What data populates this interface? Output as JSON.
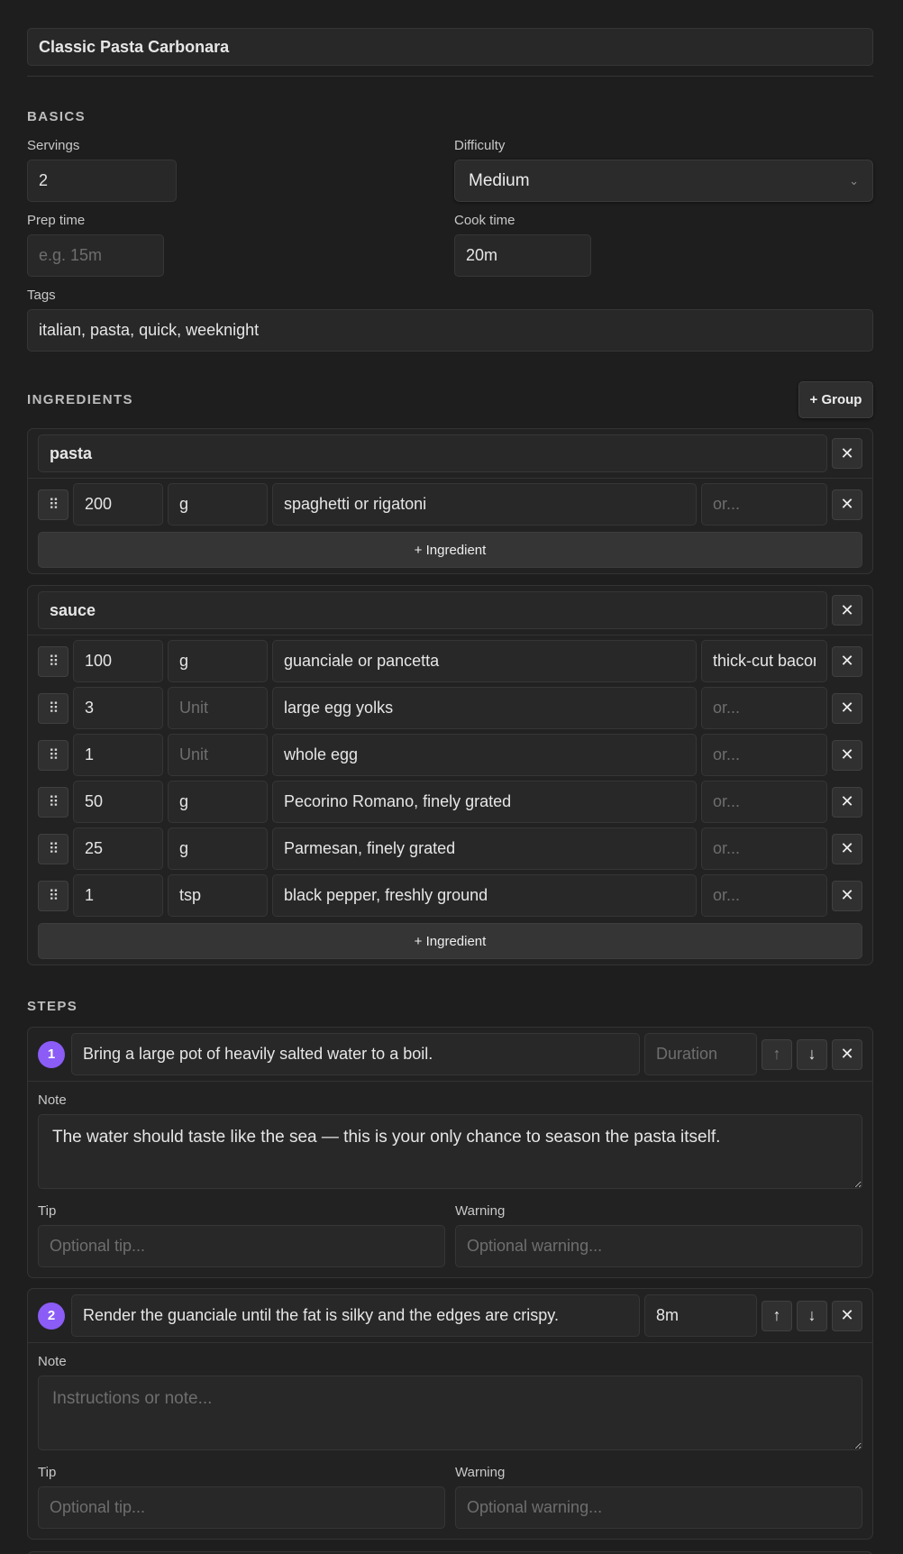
{
  "recipe": {
    "title": "Classic Pasta Carbonara"
  },
  "basics": {
    "section_label": "BASICS",
    "servings_label": "Servings",
    "servings_value": "2",
    "difficulty_label": "Difficulty",
    "difficulty_value": "Medium",
    "prep_label": "Prep time",
    "prep_value": "",
    "prep_placeholder": "e.g. 15m",
    "cook_label": "Cook time",
    "cook_value": "20m",
    "tags_label": "Tags",
    "tags_value": "italian, pasta, quick, weeknight"
  },
  "ingredients": {
    "section_label": "INGREDIENTS",
    "add_group_label": "+ Group",
    "add_ingredient_label": "+ Ingredient",
    "unit_placeholder": "Unit",
    "alt_placeholder": "or...",
    "groups": [
      {
        "name": "pasta",
        "items": [
          {
            "qty": "200",
            "unit": "g",
            "name": "spaghetti or rigatoni",
            "alt": ""
          }
        ]
      },
      {
        "name": "sauce",
        "items": [
          {
            "qty": "100",
            "unit": "g",
            "name": "guanciale or pancetta",
            "alt": "thick-cut bacon"
          },
          {
            "qty": "3",
            "unit": "",
            "name": "large egg yolks",
            "alt": ""
          },
          {
            "qty": "1",
            "unit": "",
            "name": "whole egg",
            "alt": ""
          },
          {
            "qty": "50",
            "unit": "g",
            "name": "Pecorino Romano, finely grated",
            "alt": ""
          },
          {
            "qty": "25",
            "unit": "g",
            "name": "Parmesan, finely grated",
            "alt": ""
          },
          {
            "qty": "1",
            "unit": "tsp",
            "name": "black pepper, freshly ground",
            "alt": ""
          }
        ]
      }
    ]
  },
  "steps": {
    "section_label": "STEPS",
    "duration_placeholder": "Duration",
    "note_label": "Note",
    "note_placeholder": "Instructions or note...",
    "tip_label": "Tip",
    "tip_placeholder": "Optional tip...",
    "warning_label": "Warning",
    "warning_placeholder": "Optional warning...",
    "items": [
      {
        "number": "1",
        "text": "Bring a large pot of heavily salted water to a boil.",
        "duration": "",
        "note": "The water should taste like the sea — this is your only chance to season the pasta itself.",
        "tip": "",
        "warning": ""
      },
      {
        "number": "2",
        "text": "Render the guanciale until the fat is silky and the edges are crispy.",
        "duration": "8m",
        "note": "",
        "tip": "",
        "warning": ""
      }
    ]
  },
  "icons": {
    "drag": "⠿",
    "close": "✕",
    "up": "↑",
    "down": "↓",
    "chevron": "⌄"
  }
}
